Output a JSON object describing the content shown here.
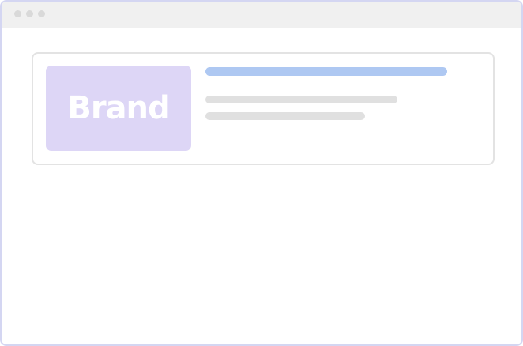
{
  "window": {
    "controls": [
      "window-dot",
      "window-dot",
      "window-dot"
    ]
  },
  "card": {
    "brand_label": "Brand",
    "colors": {
      "brand_tile": "#ddd6f6",
      "title_placeholder": "#aec8f2",
      "text_placeholder": "#e0e0e0"
    }
  }
}
